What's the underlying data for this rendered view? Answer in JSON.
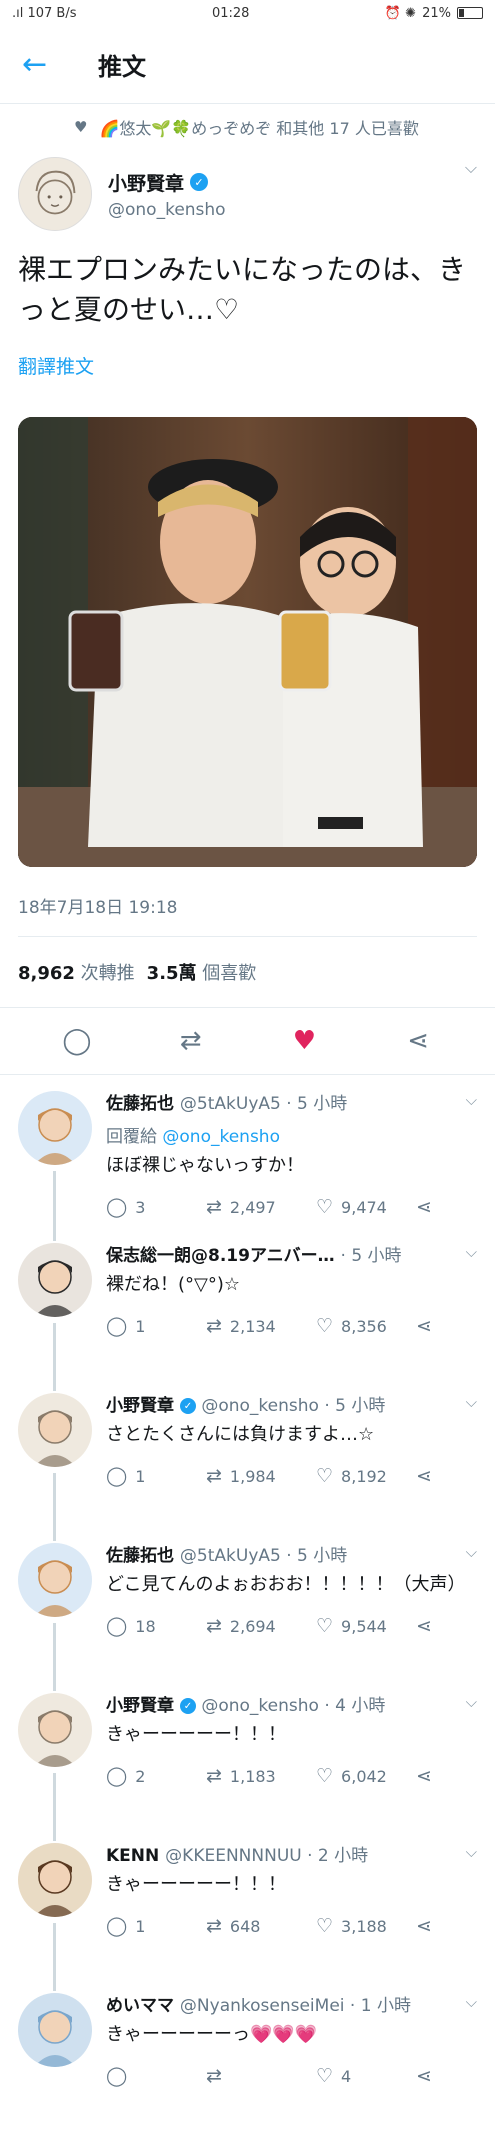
{
  "status": {
    "signal": ".ıl 107 B/s",
    "time": "01:28",
    "right_icons": "⏰ ✺",
    "battery": "21%"
  },
  "appbar": {
    "back_icon": "←",
    "title": "推文"
  },
  "liked_by": {
    "icon": "♥",
    "text": "🌈悠太🌱🍀めっぞめぞ 和其他 17 人已喜歡"
  },
  "author": {
    "name": "小野賢章",
    "handle": "@ono_kensho",
    "caret": "⌵"
  },
  "tweet": {
    "text": "裸エプロンみたいになったのは、きっと夏のせい…♡",
    "translate": "翻譯推文",
    "timestamp": "18年7月18日 19:18",
    "retweets_count": "8,962",
    "retweets_label": "次轉推",
    "likes_count": "3.5萬",
    "likes_label": "個喜歡"
  },
  "actions": {
    "reply": "◯",
    "retweet": "⇄",
    "like": "♥",
    "share": "⋖"
  },
  "replies": [
    {
      "name": "佐藤拓也",
      "handle": "@5tAkUyA5",
      "time": "5 小時",
      "verified": false,
      "reply_to_prefix": "回覆給",
      "reply_to": "@ono_kensho",
      "text": "ほぼ裸じゃないっすか！",
      "replies": "3",
      "retweets": "2,497",
      "likes": "9,474"
    },
    {
      "name": "保志総一朗@8.19アニバー…",
      "handle": "",
      "time": "5 小時",
      "verified": false,
      "reply_to_prefix": "",
      "reply_to": "",
      "text": "裸だね！(°▽°)☆",
      "replies": "1",
      "retweets": "2,134",
      "likes": "8,356"
    },
    {
      "name": "小野賢章",
      "handle": "@ono_kensho",
      "time": "5 小時",
      "verified": true,
      "reply_to_prefix": "",
      "reply_to": "",
      "text": "さとたくさんには負けますよ…☆",
      "replies": "1",
      "retweets": "1,984",
      "likes": "8,192"
    },
    {
      "name": "佐藤拓也",
      "handle": "@5tAkUyA5",
      "time": "5 小時",
      "verified": false,
      "reply_to_prefix": "",
      "reply_to": "",
      "text": "どこ見てんのよぉおおお！！！！！（大声）",
      "replies": "18",
      "retweets": "2,694",
      "likes": "9,544"
    },
    {
      "name": "小野賢章",
      "handle": "@ono_kensho",
      "time": "4 小時",
      "verified": true,
      "reply_to_prefix": "",
      "reply_to": "",
      "text": "きゃーーーーー！！！",
      "replies": "2",
      "retweets": "1,183",
      "likes": "6,042"
    },
    {
      "name": "KENN",
      "handle": "@KKEENNNNUU",
      "time": "2 小時",
      "verified": false,
      "reply_to_prefix": "",
      "reply_to": "",
      "text": "きゃーーーーー！！！",
      "replies": "1",
      "retweets": "648",
      "likes": "3,188"
    },
    {
      "name": "めいママ",
      "handle": "@NyankosenseiMei",
      "time": "1 小時",
      "verified": false,
      "reply_to_prefix": "",
      "reply_to": "",
      "text": "きゃーーーーーっ💗💗💗",
      "replies": "",
      "retweets": "",
      "likes": "4"
    }
  ]
}
